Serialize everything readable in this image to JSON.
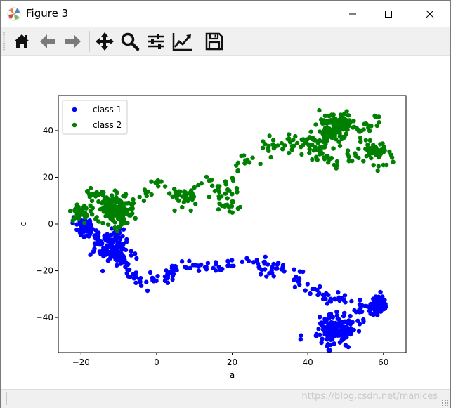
{
  "window": {
    "title": "Figure 3",
    "minimize_icon": "minimize-icon",
    "maximize_icon": "maximize-icon",
    "close_icon": "close-icon"
  },
  "toolbar": {
    "buttons": [
      {
        "name": "home-button",
        "icon": "home-icon"
      },
      {
        "name": "back-button",
        "icon": "arrow-left-icon"
      },
      {
        "name": "forward-button",
        "icon": "arrow-right-icon"
      },
      {
        "name": "pan-button",
        "icon": "move-icon"
      },
      {
        "name": "zoom-button",
        "icon": "magnifier-icon"
      },
      {
        "name": "subplots-button",
        "icon": "sliders-icon"
      },
      {
        "name": "edit-axis-button",
        "icon": "line-chart-icon"
      },
      {
        "name": "save-button",
        "icon": "floppy-disk-icon"
      }
    ]
  },
  "status": {
    "watermark": "https://blog.csdn.net/manices"
  },
  "colors": {
    "class1": "#0000ff",
    "class2": "#008000",
    "toolbar_bg": "#f0f0f0"
  },
  "chart_data": {
    "type": "scatter",
    "title": "",
    "xlabel": "a",
    "ylabel": "c",
    "xlim": [
      -26,
      66
    ],
    "ylim": [
      -55,
      55
    ],
    "xticks": [
      -20,
      0,
      20,
      40,
      60
    ],
    "yticks": [
      -40,
      -20,
      0,
      20,
      40
    ],
    "legend_position": "top-left",
    "grid": false,
    "series": [
      {
        "name": "class 1",
        "color": "#0000ff",
        "path": [
          [
            -21,
            1
          ],
          [
            -20,
            -1
          ],
          [
            -18,
            -3
          ],
          [
            -16,
            -6
          ],
          [
            -14,
            -9
          ],
          [
            -12,
            -11
          ],
          [
            -10,
            -13
          ],
          [
            -8,
            -15
          ],
          [
            -8,
            -19
          ],
          [
            -8,
            -21
          ],
          [
            -6,
            -23
          ],
          [
            -4,
            -24
          ],
          [
            -2,
            -25
          ],
          [
            0,
            -24
          ],
          [
            2,
            -23
          ],
          [
            4,
            -22
          ],
          [
            4,
            -20
          ],
          [
            6,
            -19
          ],
          [
            8,
            -18
          ],
          [
            10,
            -18
          ],
          [
            12,
            -18
          ],
          [
            14,
            -19
          ],
          [
            16,
            -18
          ],
          [
            18,
            -17
          ],
          [
            20,
            -17
          ],
          [
            22,
            -18
          ],
          [
            24,
            -17
          ],
          [
            26,
            -16
          ],
          [
            28,
            -18
          ],
          [
            30,
            -20
          ],
          [
            32,
            -19
          ],
          [
            34,
            -20
          ],
          [
            36,
            -22
          ],
          [
            38,
            -25
          ],
          [
            40,
            -27
          ],
          [
            42,
            -29
          ],
          [
            44,
            -31
          ],
          [
            46,
            -33
          ],
          [
            48,
            -33
          ],
          [
            50,
            -31
          ],
          [
            52,
            -33
          ],
          [
            54,
            -36
          ],
          [
            56,
            -35
          ],
          [
            58,
            -34
          ],
          [
            60,
            -33
          ],
          [
            58,
            -37
          ],
          [
            56,
            -40
          ],
          [
            54,
            -42
          ],
          [
            52,
            -43
          ],
          [
            50,
            -45
          ],
          [
            48,
            -46
          ],
          [
            46,
            -46
          ],
          [
            44,
            -44
          ],
          [
            46,
            -49
          ],
          [
            48,
            -42
          ]
        ],
        "clusters": [
          {
            "x": -12,
            "y": -10,
            "spread": 2.5,
            "count": 110
          },
          {
            "x": -19,
            "y": -1,
            "spread": 1.5,
            "count": 50
          },
          {
            "x": 47,
            "y": -45,
            "spread": 2.6,
            "count": 130
          },
          {
            "x": 58,
            "y": -35,
            "spread": 1.3,
            "count": 50
          }
        ],
        "trail_points": 260,
        "trail_spread": 1.2,
        "seed": 17
      },
      {
        "name": "class 2",
        "color": "#008000",
        "path": [
          [
            -21,
            5
          ],
          [
            -20,
            9
          ],
          [
            -18,
            12
          ],
          [
            -16,
            14
          ],
          [
            -14,
            10
          ],
          [
            -12,
            6
          ],
          [
            -10,
            3
          ],
          [
            -8,
            5
          ],
          [
            -6,
            8
          ],
          [
            -4,
            12
          ],
          [
            -2,
            15
          ],
          [
            0,
            16
          ],
          [
            2,
            17
          ],
          [
            4,
            14
          ],
          [
            6,
            12
          ],
          [
            8,
            13
          ],
          [
            10,
            12
          ],
          [
            8,
            9
          ],
          [
            6,
            7
          ],
          [
            8,
            11
          ],
          [
            12,
            16
          ],
          [
            14,
            20
          ],
          [
            16,
            17
          ],
          [
            18,
            12
          ],
          [
            20,
            9
          ],
          [
            18,
            6
          ],
          [
            16,
            11
          ],
          [
            18,
            14
          ],
          [
            20,
            20
          ],
          [
            22,
            24
          ],
          [
            24,
            27
          ],
          [
            26,
            29
          ],
          [
            28,
            32
          ],
          [
            30,
            33
          ],
          [
            32,
            35
          ],
          [
            34,
            36
          ],
          [
            36,
            34
          ],
          [
            38,
            35
          ],
          [
            40,
            37
          ],
          [
            42,
            35
          ],
          [
            44,
            33
          ],
          [
            42,
            30
          ],
          [
            44,
            36
          ],
          [
            46,
            39
          ],
          [
            48,
            42
          ],
          [
            50,
            45
          ],
          [
            52,
            44
          ],
          [
            48,
            40
          ],
          [
            46,
            37
          ],
          [
            44,
            40
          ],
          [
            48,
            36
          ],
          [
            52,
            33
          ],
          [
            54,
            30
          ],
          [
            56,
            26
          ],
          [
            58,
            24
          ],
          [
            60,
            27
          ],
          [
            60,
            32
          ],
          [
            56,
            35
          ],
          [
            54,
            38
          ],
          [
            56,
            42
          ],
          [
            58,
            43
          ],
          [
            54,
            32
          ],
          [
            50,
            27
          ],
          [
            48,
            26
          ],
          [
            46,
            28
          ],
          [
            44,
            30
          ],
          [
            40,
            31
          ],
          [
            36,
            32
          ]
        ],
        "clusters": [
          {
            "x": -11,
            "y": 6,
            "spread": 2.4,
            "count": 140
          },
          {
            "x": -20,
            "y": 5,
            "spread": 1.4,
            "count": 40
          },
          {
            "x": 47,
            "y": 42,
            "spread": 2.2,
            "count": 110
          },
          {
            "x": 58,
            "y": 31,
            "spread": 1.2,
            "count": 40
          }
        ],
        "trail_points": 300,
        "trail_spread": 1.3,
        "seed": 42
      }
    ]
  }
}
